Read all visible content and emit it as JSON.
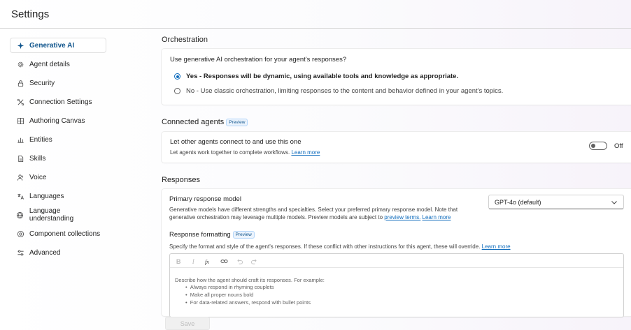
{
  "header": {
    "title": "Settings"
  },
  "sidebar": {
    "items": [
      {
        "label": "Generative AI",
        "icon": "sparkle-icon",
        "active": true
      },
      {
        "label": "Agent details",
        "icon": "gear-icon"
      },
      {
        "label": "Security",
        "icon": "lock-icon"
      },
      {
        "label": "Connection Settings",
        "icon": "plug-icon"
      },
      {
        "label": "Authoring Canvas",
        "icon": "canvas-icon"
      },
      {
        "label": "Entities",
        "icon": "entities-icon"
      },
      {
        "label": "Skills",
        "icon": "skills-icon"
      },
      {
        "label": "Voice",
        "icon": "voice-icon"
      },
      {
        "label": "Languages",
        "icon": "languages-icon"
      },
      {
        "label": "Language understanding",
        "icon": "globe-icon"
      },
      {
        "label": "Component collections",
        "icon": "collections-icon"
      },
      {
        "label": "Advanced",
        "icon": "sliders-icon"
      }
    ]
  },
  "orchestration": {
    "title": "Orchestration",
    "question": "Use generative AI orchestration for your agent's responses?",
    "option_yes": "Yes - Responses will be dynamic, using available tools and knowledge as appropriate.",
    "option_no": "No - Use classic orchestration, limiting responses to the content and behavior defined in your agent's topics.",
    "selected": "yes"
  },
  "connected_agents": {
    "title": "Connected agents",
    "badge": "Preview",
    "setting_title": "Let other agents connect to and use this one",
    "description": "Let agents work together to complete workflows.",
    "learn_more": "Learn more",
    "toggle_label": "Off"
  },
  "responses": {
    "title": "Responses",
    "primary_model": {
      "title": "Primary response model",
      "description_line1": "Generative models have different strengths and specialties. Select your preferred primary response model. Note that",
      "description_line2": "generative orchestration may leverage multiple models. Preview models are subject to",
      "preview_terms": "preview terms.",
      "learn_more": "Learn more",
      "selected_value": "GPT-4o (default)"
    },
    "formatting": {
      "title": "Response formatting",
      "badge": "Preview",
      "description": "Specify the format and style of the agent's responses. If these conflict with other instructions for this agent, these will override.",
      "learn_more": "Learn more",
      "placeholder_lines": [
        "Describe how the agent should craft its responses. For example:",
        "Always respond in rhyming couplets",
        "Make all proper nouns bold",
        "For data-related answers, respond with bullet points"
      ]
    }
  },
  "footer": {
    "save_label": "Save"
  },
  "colors": {
    "accent": "#0f6cbd",
    "active_text": "#0f548c"
  }
}
